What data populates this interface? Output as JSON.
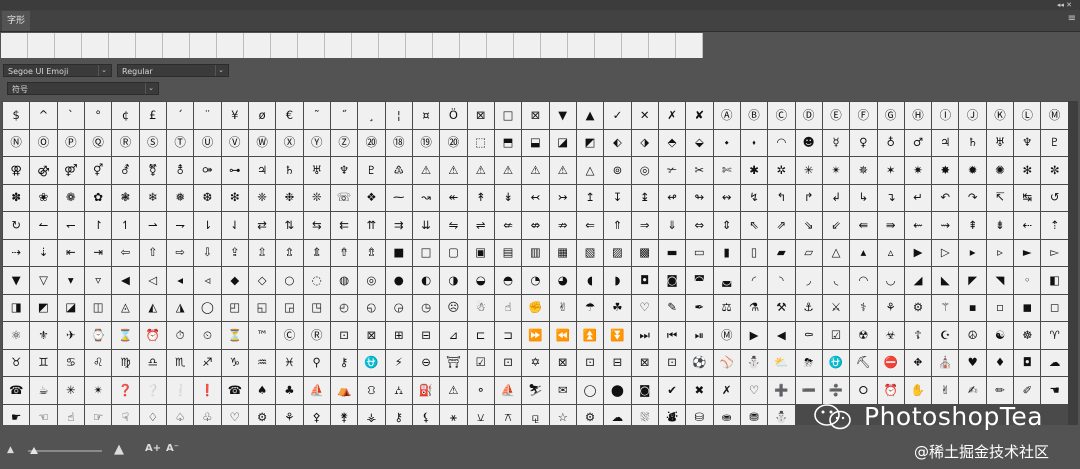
{
  "panel": {
    "tab_label": "字形",
    "menu_icon": "hamburger-menu-icon",
    "window_controls": "collapse-and-close-icons"
  },
  "recent": {
    "count": 26
  },
  "font": {
    "family": "Segoe UI Emoji",
    "style": "Regular",
    "filter": "符号"
  },
  "glyphs": [
    "$",
    "^",
    "`",
    "°",
    "¢",
    "£",
    "´",
    "¨",
    "¥",
    "ø",
    "€",
    "˜",
    "˝",
    "¸",
    "¦",
    "¤",
    "Ö",
    "⊠",
    "□",
    "⊠",
    "▼",
    "▲",
    "✓",
    "✕",
    "✗",
    "✘",
    "Ⓐ",
    "Ⓑ",
    "Ⓒ",
    "Ⓓ",
    "Ⓔ",
    "Ⓕ",
    "Ⓖ",
    "Ⓗ",
    "Ⓘ",
    "Ⓙ",
    "Ⓚ",
    "Ⓛ",
    "Ⓜ",
    "Ⓝ",
    "Ⓞ",
    "Ⓟ",
    "Ⓠ",
    "Ⓡ",
    "Ⓢ",
    "Ⓣ",
    "Ⓤ",
    "Ⓥ",
    "Ⓦ",
    "Ⓧ",
    "Ⓨ",
    "Ⓩ",
    "⑳",
    "⑱",
    "⑲",
    "⑳",
    "⬚",
    "⬒",
    "⬓",
    "◪",
    "◩",
    "⬖",
    "⬗",
    "⬘",
    "⬙",
    "⬩",
    "⬪",
    "◠",
    "☻",
    "☿",
    "♀",
    "♁",
    "♂",
    "♃",
    "♄",
    "♅",
    "♆",
    "♇",
    "⚢",
    "⚣",
    "⚤",
    "⚥",
    "⚦",
    "⚧",
    "⚨",
    "⚩",
    "⊶",
    "♃",
    "♄",
    "♅",
    "♆",
    "♇",
    "♳",
    "⚠",
    "⚠",
    "⚠",
    "⚠",
    "⚠",
    "⚠",
    "△",
    "⊚",
    "◎",
    "✃",
    "✂",
    "✄",
    "✱",
    "✲",
    "✳",
    "✴",
    "✵",
    "✶",
    "✷",
    "✸",
    "✹",
    "✺",
    "✻",
    "✼",
    "✽",
    "❀",
    "❁",
    "✿",
    "❃",
    "❄",
    "❅",
    "❆",
    "❇",
    "❈",
    "❉",
    "❊",
    "☏",
    "❖",
    "⁓",
    "↝",
    "↞",
    "↟",
    "↡",
    "↢",
    "↣",
    "↥",
    "↧",
    "↨",
    "↫",
    "↬",
    "↭",
    "↯",
    "↰",
    "↱",
    "↲",
    "↳",
    "↴",
    "↵",
    "↶",
    "↷",
    "↸",
    "↹",
    "↺",
    "↻",
    "↼",
    "↽",
    "↾",
    "↿",
    "⇀",
    "⇁",
    "⇂",
    "⇃",
    "⇄",
    "⇅",
    "⇆",
    "⇇",
    "⇈",
    "⇉",
    "⇊",
    "⇋",
    "⇌",
    "⇍",
    "⇎",
    "⇏",
    "⇐",
    "⇑",
    "⇒",
    "⇓",
    "⇔",
    "⇕",
    "⇖",
    "⇗",
    "⇘",
    "⇙",
    "⇚",
    "⇛",
    "⇜",
    "⇝",
    "⇞",
    "⇟",
    "⇠",
    "⇡",
    "⇢",
    "⇣",
    "⇤",
    "⇥",
    "⇦",
    "⇧",
    "⇨",
    "⇩",
    "⇪",
    "⇫",
    "⇬",
    "⇭",
    "⇮",
    "⇯",
    "■",
    "□",
    "▢",
    "▣",
    "▤",
    "▥",
    "▦",
    "▧",
    "▨",
    "▩",
    "▬",
    "▭",
    "▮",
    "▯",
    "▰",
    "▱",
    "△",
    "▴",
    "▵",
    "▶",
    "▷",
    "▸",
    "▹",
    "►",
    "▻",
    "▼",
    "▽",
    "▾",
    "▿",
    "◀",
    "◁",
    "◂",
    "◃",
    "◆",
    "◇",
    "○",
    "◌",
    "◍",
    "◎",
    "●",
    "◐",
    "◑",
    "◒",
    "◓",
    "◔",
    "◕",
    "◖",
    "◗",
    "◘",
    "◙",
    "◚",
    "◛",
    "◜",
    "◝",
    "◞",
    "◟",
    "◠",
    "◡",
    "◢",
    "◣",
    "◤",
    "◥",
    "◦",
    "◧",
    "◨",
    "◩",
    "◪",
    "◫",
    "◬",
    "◭",
    "◮",
    "◯",
    "◰",
    "◱",
    "◲",
    "◳",
    "◴",
    "◵",
    "◶",
    "◷",
    "☹",
    "☃",
    "☝",
    "✊",
    "✌",
    "☂",
    "☘",
    "♡",
    "✎",
    "✒",
    "⚖",
    "⚗",
    "⚒",
    "⚓",
    "⚔",
    "⚕",
    "⚘",
    "⚙",
    "⚚",
    "▪",
    "▫",
    "◼",
    "◻",
    "⚛",
    "⚜",
    "✈",
    "⌚",
    "⌛",
    "⏰",
    "⏱",
    "⏲",
    "⏳",
    "™",
    "Ⓒ",
    "Ⓡ",
    "⊡",
    "⊠",
    "⊞",
    "⊟",
    "⊿",
    "⊏",
    "⊐",
    "⏩",
    "⏪",
    "⏫",
    "⏬",
    "⏭",
    "⏮",
    "⏯",
    "Ⓜ",
    "▶",
    "◀",
    "⚰",
    "☑",
    "☢",
    "☣",
    "☦",
    "☪",
    "☮",
    "☯",
    "☸",
    "♈",
    "♉",
    "♊",
    "♋",
    "♌",
    "♍",
    "♎",
    "♏",
    "♐",
    "♑",
    "♒",
    "♓",
    "⚲",
    "⚷",
    "⛎",
    "⚡",
    "⊖",
    "⛩",
    "☑",
    "⊡",
    "✡",
    "⊠",
    "⊡",
    "⊟",
    "⊠",
    "⊡",
    "⚽",
    "⚾",
    "⛄",
    "⛅",
    "⛈",
    "⛎",
    "⛏",
    "⛔",
    "⛖",
    "⛪",
    "♥",
    "♦",
    "◘",
    "☁",
    "☎",
    "☕",
    "✳",
    "✴",
    "❓",
    "❔",
    "❕",
    "❗",
    "☎",
    "♠",
    "♣",
    "⛵",
    "⛺",
    "⛻",
    "⛼",
    "⛽",
    "⚠",
    "⚬",
    "⛵",
    "⛷",
    "✉",
    "◯",
    "⬤",
    "◙",
    "✔",
    "✖",
    "✗",
    "♡",
    "➕",
    "➖",
    "➗",
    "⭘",
    "⏰",
    "✋",
    "✌",
    "✍",
    "✏",
    "✐",
    "☚",
    "☛",
    "☜",
    "☝",
    "☞",
    "☟",
    "♢",
    "♤",
    "♧",
    "♡",
    "⚙",
    "⚘",
    "⚴",
    "⚵",
    "⚶",
    "⚷",
    "⚸",
    "⚹",
    "⚺",
    "⚻",
    "⚼",
    "☆",
    "⚙",
    "☁",
    "⛆",
    "⛇",
    "⛁",
    "⛂",
    "⛃",
    "⛄"
  ],
  "bottom": {
    "zoom_small_icon": "small-mountain-icon",
    "zoom_large_icon": "large-mountain-icon",
    "zoom_level": 0.08,
    "increase_size": "A+",
    "decrease_size": "A⁻"
  },
  "watermark": {
    "text": "PhotoshopTea",
    "logo": "wechat-logo-icon"
  },
  "credit": "@稀土掘金技术社区"
}
